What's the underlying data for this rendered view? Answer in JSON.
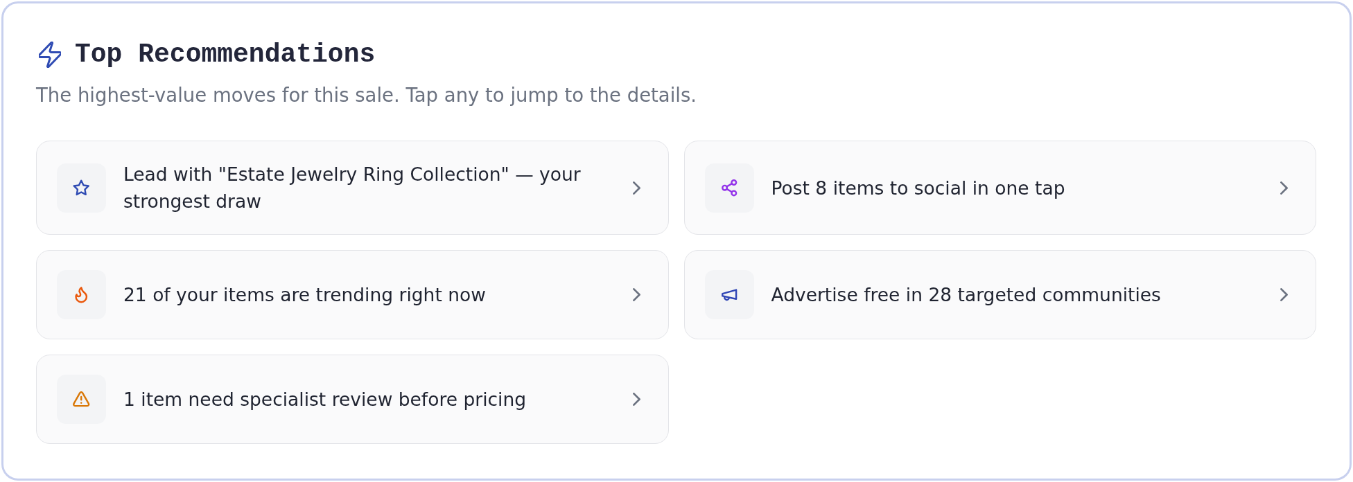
{
  "header": {
    "title": "Top Recommendations",
    "subtitle": "The highest-value moves for this sale. Tap any to jump to the details."
  },
  "recommendations": [
    {
      "kind": "star",
      "color": "#2f4bb3",
      "text": "Lead with \"Estate Jewelry Ring Collection\" — your strongest draw"
    },
    {
      "kind": "share",
      "color": "#9333ea",
      "text": "Post 8 items to social in one tap"
    },
    {
      "kind": "flame",
      "color": "#ea580c",
      "text": "21 of your items are trending right now"
    },
    {
      "kind": "megaphone",
      "color": "#2f45b5",
      "text": "Advertise free in 28 targeted communities"
    },
    {
      "kind": "warning",
      "color": "#d97706",
      "text": "1 item need specialist review before pricing"
    }
  ]
}
